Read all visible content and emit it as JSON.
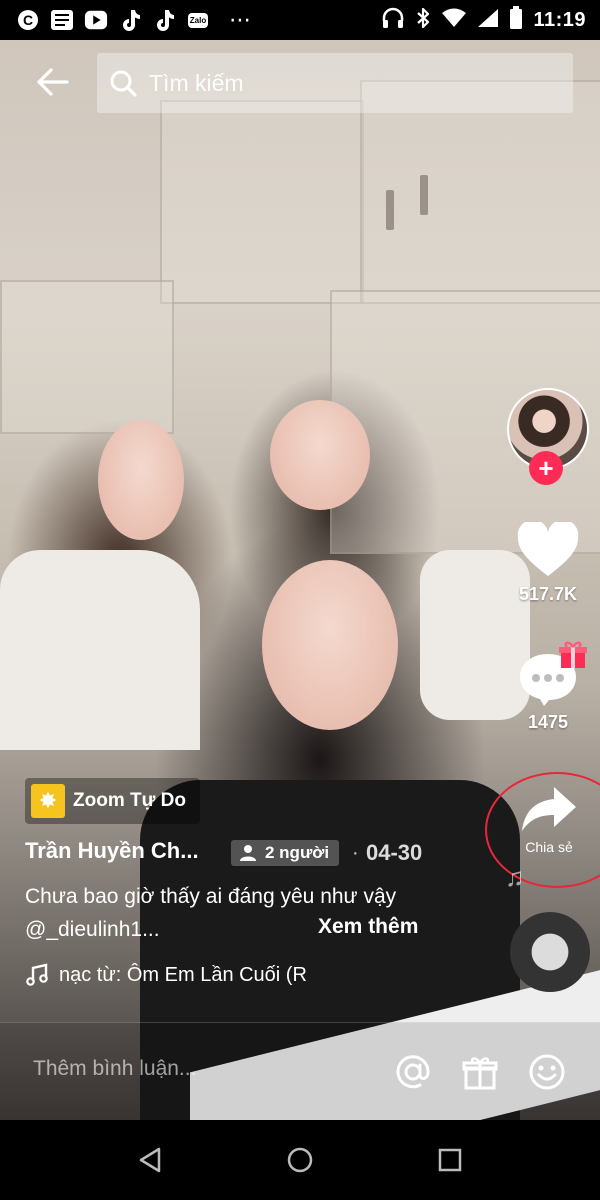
{
  "status_bar": {
    "time": "11:19",
    "left_icons": [
      "copyright-icon",
      "news-icon",
      "youtube-icon",
      "tiktok-icon",
      "tiktok-icon",
      "zalo-icon",
      "more-dots-icon"
    ],
    "zalo_label": "Zalo",
    "more_label": "⋯"
  },
  "search": {
    "placeholder": "Tìm kiếm"
  },
  "right_rail": {
    "likes": "517.7K",
    "comments": "1475",
    "share_label": "Chia sẻ",
    "follow_symbol": "+"
  },
  "video_info": {
    "effect_label": "Zoom Tự Do",
    "author": "Trần Huyền Ch...",
    "people_tag": "2 người",
    "separator": "·",
    "date": "04-30",
    "caption": "Chưa bao giờ thấy ai đáng yêu như vậy @_dieulinh1...",
    "see_more": "Xem thêm",
    "music": "nạc từ: Ôm Em Lần Cuối (R"
  },
  "comment_bar": {
    "placeholder": "Thêm bình luận..."
  },
  "colors": {
    "follow": "#fe2c55",
    "highlight_circle": "#e5283a",
    "effect_icon": "#f5c41e"
  }
}
